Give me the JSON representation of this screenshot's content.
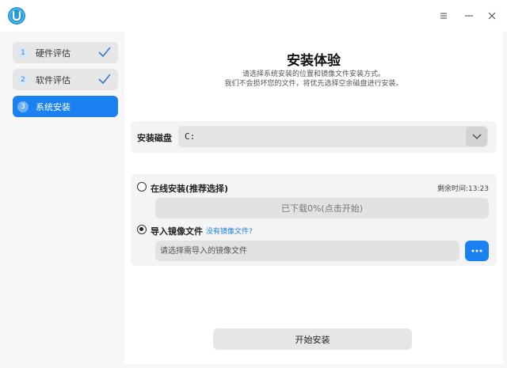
{
  "window": {
    "title_icon": "app-logo-icon"
  },
  "sidebar": {
    "steps": [
      {
        "number": "1",
        "label": "硬件评估",
        "done": true
      },
      {
        "number": "2",
        "label": "软件评估",
        "done": true
      },
      {
        "number": "3",
        "label": "系统安装",
        "done": false,
        "active": true
      }
    ]
  },
  "main": {
    "title": "安装体验",
    "subtitle_line1": "请选择系统安装的位置和镜像文件安装方式。",
    "subtitle_line2": "我们不会损坏您的文件，将优先选择空余磁盘进行安装。",
    "disk": {
      "label": "安装磁盘",
      "value": "C:"
    },
    "online": {
      "label": "在线安装(推荐选择)",
      "selected": false,
      "remaining": "剩余时间:13:23",
      "download_status": "已下载0%(点击开始)"
    },
    "image": {
      "label": "导入镜像文件",
      "selected": true,
      "no_image_link": "没有镜像文件?",
      "placeholder": "请选择需导入的镜像文件",
      "value": ""
    },
    "start_button": "开始安装"
  },
  "colors": {
    "accent": "#1a82f0",
    "logo": "#1f9bd9",
    "link": "#1a7fe8"
  }
}
